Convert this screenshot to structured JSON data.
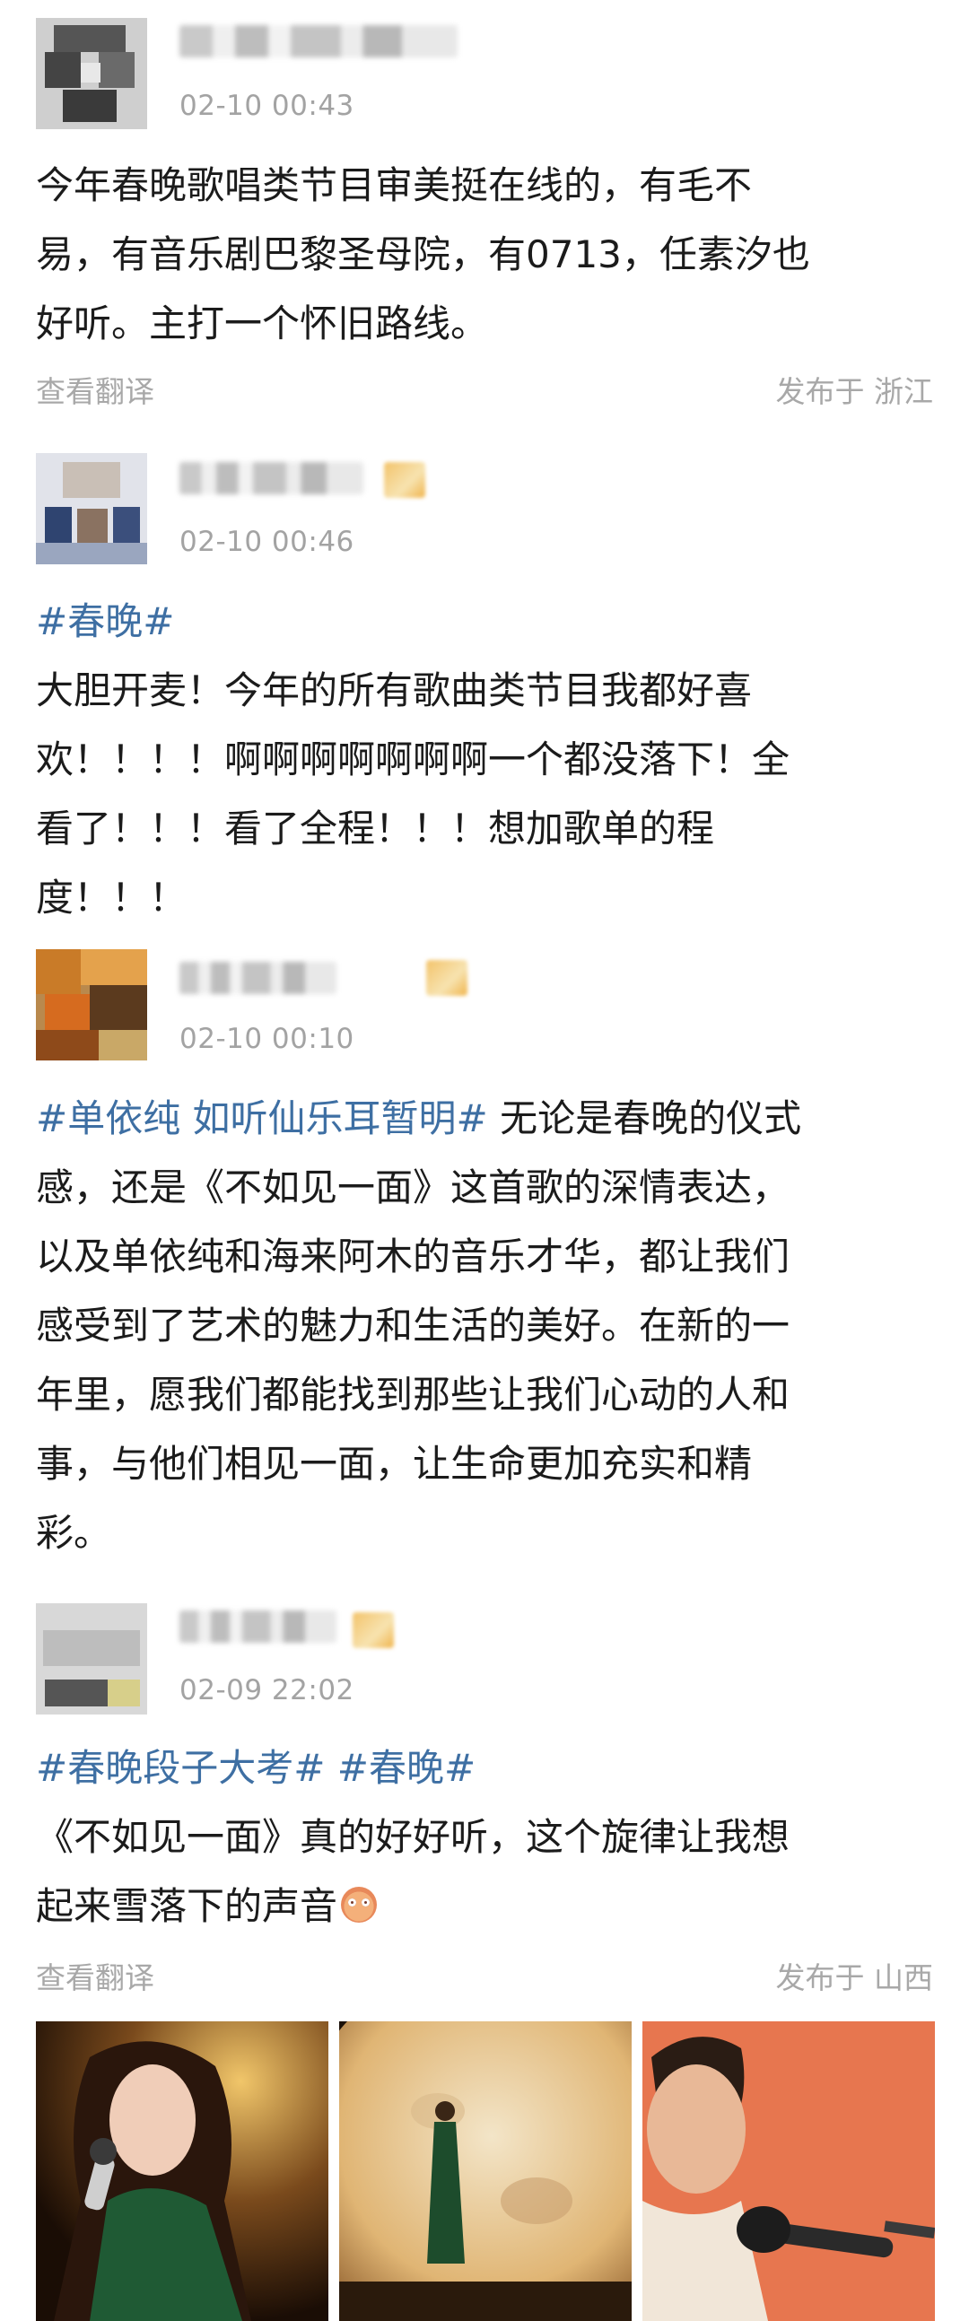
{
  "posts": [
    {
      "time": "02-10 00:43",
      "lines": [
        [
          {
            "t": "今年春晚歌唱类节目审美挺在线的，有毛不"
          }
        ],
        [
          {
            "t": "易，有音乐剧巴黎圣母院，有0713，任素汐也"
          }
        ],
        [
          {
            "t": "好听。主打一个怀旧路线。"
          }
        ]
      ],
      "translate": "查看翻译",
      "location": "发布于 浙江"
    },
    {
      "time": "02-10 00:46",
      "lines": [
        [
          {
            "t": "#春晚#",
            "tag": true
          }
        ],
        [
          {
            "t": "大胆开麦！今年的所有歌曲类节目我都好喜"
          }
        ],
        [
          {
            "t": "欢！！！！啊啊啊啊啊啊啊一个都没落下！全"
          }
        ],
        [
          {
            "t": "看了！！！看了全程！！！想加歌单的程"
          }
        ],
        [
          {
            "t": "度！！！"
          }
        ]
      ]
    },
    {
      "time": "02-10 00:10",
      "lines": [
        [
          {
            "t": "#单依纯 如听仙乐耳暂明#",
            "tag": true
          },
          {
            "t": " 无论是春晚的仪式"
          }
        ],
        [
          {
            "t": "感，还是《不如见一面》这首歌的深情表达，"
          }
        ],
        [
          {
            "t": "以及单依纯和海来阿木的音乐才华，都让我们"
          }
        ],
        [
          {
            "t": "感受到了艺术的魅力和生活的美好。在新的一"
          }
        ],
        [
          {
            "t": "年里，愿我们都能找到那些让我们心动的人和"
          }
        ],
        [
          {
            "t": "事，与他们相见一面，让生命更加充实和精"
          }
        ],
        [
          {
            "t": "彩。"
          }
        ]
      ]
    },
    {
      "time": "02-09 22:02",
      "lines": [
        [
          {
            "t": "#春晚段子大考#",
            "tag": true
          },
          {
            "t": " "
          },
          {
            "t": "#春晚#",
            "tag": true
          }
        ],
        [
          {
            "t": "《不如见一面》真的好好听，这个旋律让我想"
          }
        ],
        [
          {
            "t": "起来雪落下的声音"
          }
        ]
      ],
      "translate": "查看翻译",
      "location": "发布于 山西"
    }
  ],
  "photos": [
    "singer-closeup-photo",
    "stage-moon-photo",
    "male-singer-photo"
  ],
  "colors": {
    "tag": "#3e6fa3",
    "meta": "#a8a8a8",
    "time": "#a3a3a3"
  }
}
